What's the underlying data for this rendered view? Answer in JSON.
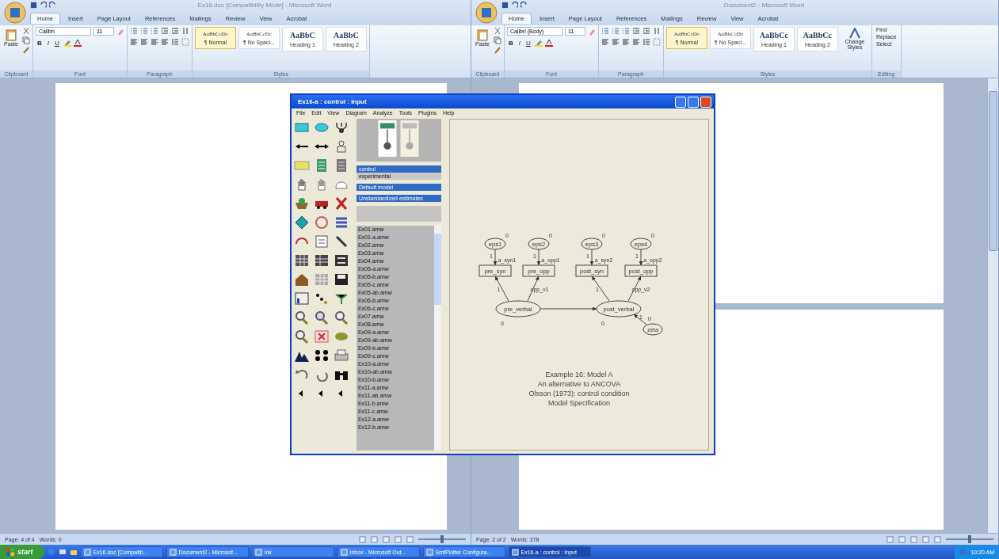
{
  "word_windows": [
    {
      "title": "Ex16.doc [Compatibility Mode] - Microsoft Word",
      "tabs": [
        {
          "label": "Home",
          "selected": true
        },
        {
          "label": "Insert",
          "selected": false
        },
        {
          "label": "Page Layout",
          "selected": false
        },
        {
          "label": "References",
          "selected": false
        },
        {
          "label": "Mailings",
          "selected": false
        },
        {
          "label": "Review",
          "selected": false
        },
        {
          "label": "View",
          "selected": false
        },
        {
          "label": "Acrobat",
          "selected": false
        }
      ],
      "paste": "Paste",
      "font": "Calibri",
      "size": "11",
      "format_buttons": [
        "B",
        "I",
        "U"
      ],
      "styles": [
        {
          "preview": "AaBbCcDc",
          "name": "¶ Normal",
          "selected": true
        },
        {
          "preview": "AaBbCcDc",
          "name": "¶ No Spaci...",
          "selected": false
        },
        {
          "preview": "AaBbC",
          "name": "Heading 1",
          "selected": false
        },
        {
          "preview": "AaBbC",
          "name": "Heading 2",
          "selected": false
        }
      ],
      "groups": [
        "Clipboard",
        "Font",
        "Paragraph",
        "Styles"
      ],
      "pages": [
        {
          "kind": "page"
        }
      ],
      "status": {
        "page": "Page: 4 of 4",
        "words": "Words: 0"
      },
      "zoom_slider": {
        "level": 0.5
      }
    },
    {
      "title": "Document2 - Microsoft Word",
      "tabs": [
        {
          "label": "Home",
          "selected": true
        },
        {
          "label": "Insert",
          "selected": false
        },
        {
          "label": "Page Layout",
          "selected": false
        },
        {
          "label": "References",
          "selected": false
        },
        {
          "label": "Mailings",
          "selected": false
        },
        {
          "label": "Review",
          "selected": false
        },
        {
          "label": "View",
          "selected": false
        },
        {
          "label": "Acrobat",
          "selected": false
        }
      ],
      "paste": "Paste",
      "font": "Calibri (Body)",
      "size": "11",
      "format_buttons": [
        "B",
        "I",
        "U"
      ],
      "styles": [
        {
          "preview": "AaBbCcDc",
          "name": "¶ Normal",
          "selected": true
        },
        {
          "preview": "AaBbCcDc",
          "name": "¶ No Spaci...",
          "selected": false
        },
        {
          "preview": "AaBbCc",
          "name": "Heading 1",
          "selected": false
        },
        {
          "preview": "AaBbCc",
          "name": "Heading 2",
          "selected": false
        }
      ],
      "change_styles": "Change Styles",
      "editing": [
        "Find",
        "Replace",
        "Select"
      ],
      "groups": [
        "Clipboard",
        "Font",
        "Paragraph",
        "Styles",
        "Editing"
      ],
      "pages": [
        {
          "kind": "page"
        },
        {
          "kind": "page"
        }
      ],
      "status": {
        "page": "Page: 2 of 2",
        "words": "Words: 378"
      },
      "zoom_slider": {
        "level": 0.5
      }
    }
  ],
  "amos": {
    "title": "Ex16-a : control : Input",
    "menu": [
      "File",
      "Edit",
      "View",
      "Diagram",
      "Analyze",
      "Tools",
      "Plugins",
      "Help"
    ],
    "groups": [
      {
        "label": "control",
        "selected": true
      },
      {
        "label": "experimental",
        "selected": false
      }
    ],
    "models": [
      {
        "label": "Default model",
        "selected": true
      }
    ],
    "estimates": [
      {
        "label": "Unstandardized estimates",
        "selected": true
      }
    ],
    "files": [
      "Ex01.amw",
      "Ex01-a.amw",
      "Ex02.amw",
      "Ex03.amw",
      "Ex04.amw",
      "Ex05-a.amw",
      "Ex05-b.amw",
      "Ex05-c.amw",
      "Ex05-ab.amw",
      "Ex06-b.amw",
      "Ex06-c.amw",
      "Ex07.amw",
      "Ex08.amw",
      "Ex09-a.amw",
      "Ex09-ab.amw",
      "Ex09-b.amw",
      "Ex09-c.amw",
      "Ex10-a.amw",
      "Ex10-ab.amw",
      "Ex10-b.amw",
      "Ex11-a.amw",
      "Ex11-ab.amw",
      "Ex11-b.amw",
      "Ex11-c.amw",
      "Ex12-a.amw",
      "Ex12-b.amw"
    ],
    "diagram": {
      "errors": [
        {
          "name": "eps1",
          "variance": "0",
          "weight": "1"
        },
        {
          "name": "eps2",
          "variance": "0",
          "weight": "1"
        },
        {
          "name": "eps3",
          "variance": "0",
          "weight": "1"
        },
        {
          "name": "eps4",
          "variance": "0",
          "weight": "1"
        }
      ],
      "observed": [
        {
          "name": "pre_syn",
          "intercept": "a_syn1"
        },
        {
          "name": "pre_opp",
          "intercept": "a_opp1"
        },
        {
          "name": "post_syn",
          "intercept": "a_syn2"
        },
        {
          "name": "post_opp",
          "intercept": "a_opp2"
        }
      ],
      "loadings": [
        "1",
        "opp_v1",
        "1",
        "opp_v2"
      ],
      "latents": [
        {
          "name": "pre_verbal",
          "variance": "0"
        },
        {
          "name": "post_verbal",
          "variance": "0"
        }
      ],
      "residual": {
        "name": "zeta",
        "variance": "0",
        "weight": "1"
      }
    },
    "caption": [
      "Example 16: Model A",
      "An alternative to ANCOVA",
      "Olsson (1973): control condition",
      "Model Specification"
    ]
  },
  "taskbar": {
    "start": "start",
    "tasks": [
      {
        "label": "Ex16.doc [Compatib...",
        "selected": false
      },
      {
        "label": "Document2 - Microsof...",
        "selected": false
      },
      {
        "label": "Ink",
        "selected": false
      },
      {
        "label": "Inbox - Microsoft Out...",
        "selected": false
      },
      {
        "label": "SmtPlotter Configura...",
        "selected": false
      },
      {
        "label": "Ex16-a : control : Input",
        "selected": true
      }
    ],
    "clock": "10:20 AM"
  }
}
